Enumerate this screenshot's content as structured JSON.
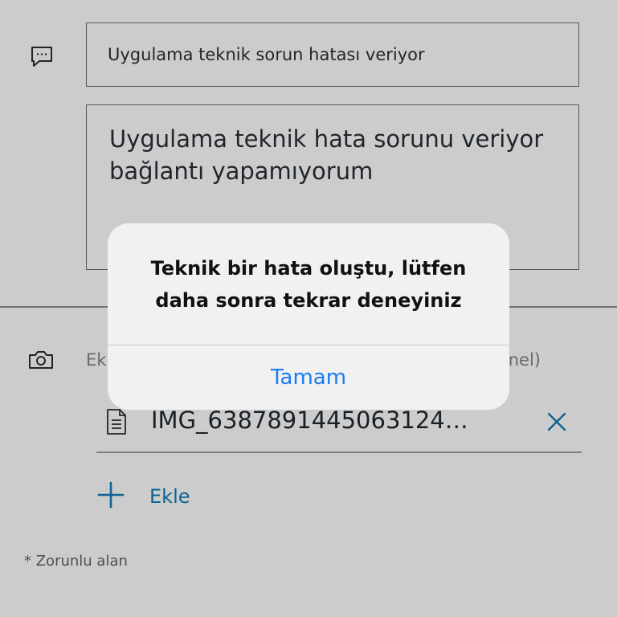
{
  "form": {
    "subject_value": "Uygulama teknik sorun hatası veriyor",
    "description_value": "Uygulama teknik hata sorunu veriyor bağlantı yapamıyorum",
    "attachment_label_left": "Ek",
    "attachment_label_right": "nel)",
    "attachment_file_name": "IMG_6387891445063124…",
    "add_label": "Ekle",
    "required_note": "* Zorunlu alan"
  },
  "icons": {
    "subject": "chat-bubble-icon",
    "attachment": "camera-icon",
    "file": "document-icon",
    "remove": "close-icon",
    "add": "plus-icon"
  },
  "alert": {
    "message": "Teknik bir hata oluştu, lütfen daha sonra tekrar deneyiniz",
    "button_label": "Tamam"
  },
  "colors": {
    "accent": "#0e7db8",
    "ios_button": "#1a7cf0"
  }
}
